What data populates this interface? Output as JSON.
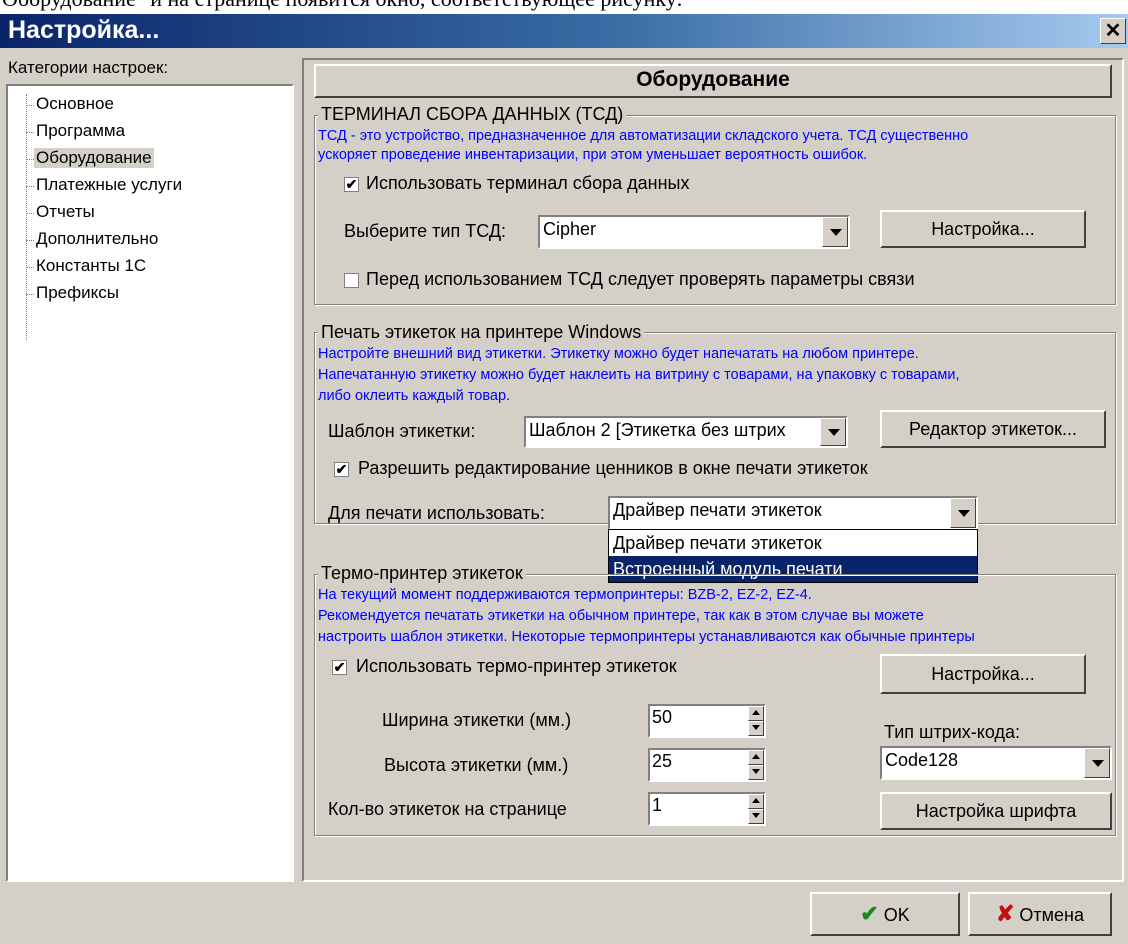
{
  "top_text": "Оборудование\" и на странице появится окно, соответствующее рисунку:",
  "window": {
    "title": "Настройка..."
  },
  "sidebar": {
    "heading": "Категории настроек:",
    "items": [
      {
        "label": "Основное"
      },
      {
        "label": "Программа"
      },
      {
        "label": "Оборудование"
      },
      {
        "label": "Платежные услуги"
      },
      {
        "label": "Отчеты"
      },
      {
        "label": "Дополнительно"
      },
      {
        "label": "Константы 1С"
      },
      {
        "label": "Префиксы"
      }
    ]
  },
  "panel": {
    "title": "Оборудование"
  },
  "tsd": {
    "title": "ТЕРМИНАЛ СБОРА ДАННЫХ (ТСД)",
    "desc1": "ТСД - это устройство, предназначенное для автоматизации складского учета. ТСД существенно",
    "desc2": "ускоряет проведение инвентаризации, при этом уменьшает вероятность ошибок.",
    "use_label": "Использовать терминал сбора данных",
    "use_checked": "✔",
    "type_label": "Выберите тип ТСД:",
    "type_value": "Cipher",
    "settings_button": "Настройка...",
    "check_label": "Перед использованием ТСД следует проверять параметры связи",
    "check_checked": ""
  },
  "labels": {
    "title": "Печать этикеток на принтере Windows",
    "desc1": "Настройте внешний вид этикетки. Этикетку можно будет напечатать на любом принтере.",
    "desc2": "Напечатанную этикетку можно будет наклеить на витрину с товарами, на упаковку с товарами,",
    "desc3": "либо оклеить каждый товар.",
    "template_label": "Шаблон этикетки:",
    "template_value": "Шаблон 2 [Этикетка без штрих",
    "editor_button": "Редактор этикеток...",
    "allow_label": "Разрешить редактирование ценников в окне печати этикеток",
    "allow_checked": "✔",
    "print_label": "Для печати использовать:",
    "print_value": "Драйвер печати этикеток",
    "options": [
      "Драйвер печати этикеток",
      "Встроенный модуль печати"
    ]
  },
  "thermo": {
    "title": "Термо-принтер этикеток",
    "desc1": "На текущий момент поддерживаются термопринтеры: BZB-2, EZ-2, EZ-4.",
    "desc2": "Рекомендуется печатать этикетки на обычном принтере, так как в этом случае вы можете",
    "desc3": "настроить шаблон этикетки. Некоторые термопринтеры устанавливаются как обычные принтеры",
    "use_label": "Использовать термо-принтер этикеток",
    "use_checked": "✔",
    "settings_button": "Настройка...",
    "width_label": "Ширина этикетки (мм.)",
    "width_value": "50",
    "height_label": "Высота этикетки (мм.)",
    "height_value": "25",
    "count_label": "Кол-во этикеток на странице",
    "count_value": "1",
    "barcode_label": "Тип штрих-кода:",
    "barcode_value": "Code128",
    "font_button": "Настройка шрифта"
  },
  "footer": {
    "ok_label": "OK",
    "cancel_label": "Отмена"
  },
  "colors": {
    "title_start": "#0a246a",
    "title_end": "#a6caf0",
    "face": "#d4d0c8",
    "info_text": "#0000ff",
    "highlight": "#0a246a"
  }
}
